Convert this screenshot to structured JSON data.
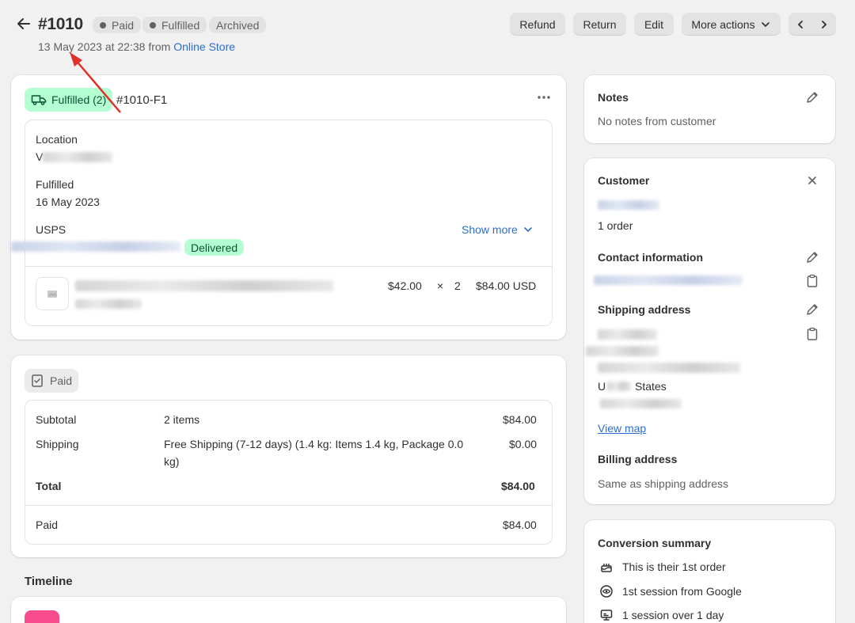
{
  "header": {
    "order_number": "#1010",
    "badges": [
      "Paid",
      "Fulfilled",
      "Archived"
    ],
    "date_text": "13 May 2023 at 22:38 from",
    "channel_link": "Online Store",
    "actions": [
      "Refund",
      "Return",
      "Edit",
      "More actions"
    ]
  },
  "fulfillment": {
    "status_label": "Fulfilled (2)",
    "fulfillment_id": "#1010-F1",
    "location_label": "Location",
    "location_value": "V",
    "fulfilled_label": "Fulfilled",
    "fulfilled_date": "16 May 2023",
    "carrier": "USPS",
    "show_more": "Show more",
    "delivered": "Delivered",
    "item_price": "$42.00",
    "item_times": "×",
    "item_qty": "2",
    "item_total": "$84.00 USD"
  },
  "payment": {
    "badge": "Paid",
    "rows": [
      {
        "label": "Subtotal",
        "detail": "2 items",
        "amount": "$84.00"
      },
      {
        "label": "Shipping",
        "detail": "Free Shipping (7-12 days) (1.4 kg: Items 1.4 kg, Package 0.0",
        "detail2": "kg)",
        "amount": "$0.00"
      },
      {
        "label": "Total",
        "detail": "",
        "amount": "$84.00"
      }
    ],
    "paid_label": "Paid",
    "paid_amount": "$84.00"
  },
  "timeline": {
    "title": "Timeline"
  },
  "notes": {
    "title": "Notes",
    "text": "No notes from customer"
  },
  "customer": {
    "title": "Customer",
    "orders": "1 order",
    "contact_title": "Contact information",
    "shipping_title": "Shipping address",
    "address_line_4": "U",
    "address_line_4b": "States",
    "view_map": "View map",
    "billing_title": "Billing address",
    "billing_text": "Same as shipping address"
  },
  "conversion": {
    "title": "Conversion summary",
    "items": [
      "This is their 1st order",
      "1st session from Google",
      "1 session over 1 day"
    ]
  },
  "colors": {
    "accent_link": "#2c6ecb",
    "fulfilled_green": "#b4fed2",
    "annotation_arrow": "#e0302a"
  }
}
